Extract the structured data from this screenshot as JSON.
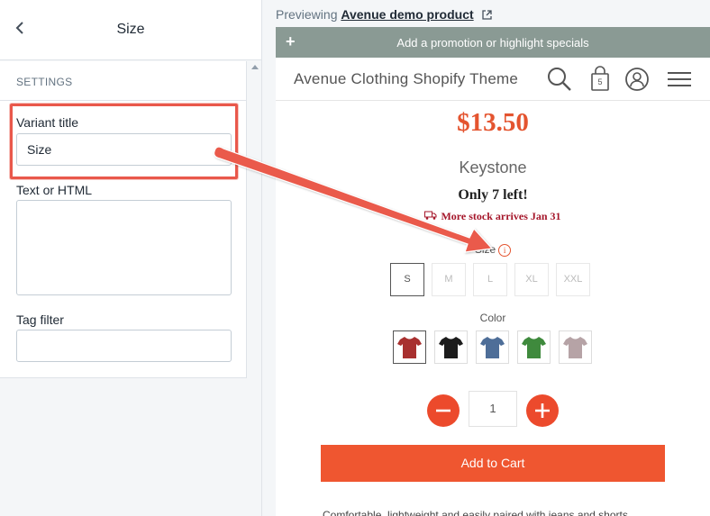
{
  "editor": {
    "title": "Size",
    "back_icon": "chevron-left-icon",
    "section_label": "SETTINGS",
    "fields": {
      "variant_title": {
        "label": "Variant title",
        "value": "Size"
      },
      "text_or_html": {
        "label": "Text or HTML",
        "value": ""
      },
      "tag_filter": {
        "label": "Tag filter",
        "value": ""
      }
    },
    "highlight_color": "#e9584b"
  },
  "preview": {
    "previewing_label": "Previewing",
    "product_link": "Avenue demo product",
    "promo_bar": {
      "text": "Add a promotion or highlight specials",
      "color": "#8a9a94"
    },
    "store_name": "Avenue Clothing Shopify Theme",
    "cart_count": "5",
    "product": {
      "price": "$13.50",
      "name": "Keystone",
      "stock_message": "Only 7 left!",
      "restock_message": "More stock arrives Jan 31",
      "size_label": "Size",
      "info_glyph": "i",
      "sizes": [
        "S",
        "M",
        "L",
        "XL",
        "XXL"
      ],
      "selected_size": "S",
      "color_label": "Color",
      "colors": [
        {
          "name": "red",
          "hex": "#a8302f"
        },
        {
          "name": "black",
          "hex": "#1c1c1c"
        },
        {
          "name": "blue",
          "hex": "#4e6e98"
        },
        {
          "name": "green",
          "hex": "#3f8a3d"
        },
        {
          "name": "heather",
          "hex": "#b6a3a6"
        }
      ],
      "selected_color": "red",
      "quantity": "1",
      "add_to_cart": "Add to Cart",
      "description_snippet": "Comfortable, lightweight and easily paired with jeans and shorts."
    },
    "accent_color": "#ef5630",
    "price_color": "#e4542f"
  }
}
